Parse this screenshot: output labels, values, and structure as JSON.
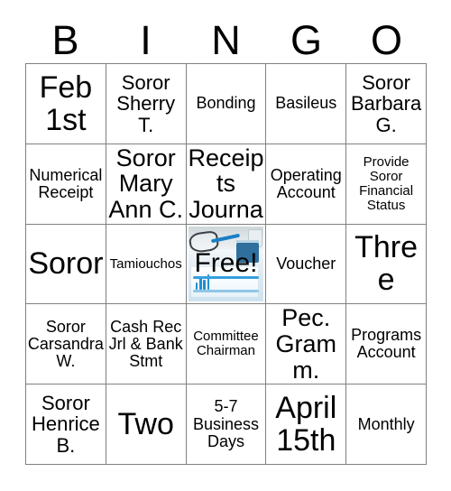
{
  "header": {
    "letters": [
      "B",
      "I",
      "N",
      "G",
      "O"
    ]
  },
  "grid": {
    "rows": [
      [
        {
          "text": "Feb 1st",
          "size": "fs-xxl",
          "free": false
        },
        {
          "text": "Soror Sherry T.",
          "size": "fs-lg",
          "free": false
        },
        {
          "text": "Bonding",
          "size": "fs-md",
          "free": false
        },
        {
          "text": "Basileus",
          "size": "fs-md",
          "free": false
        },
        {
          "text": "Soror Barbara G.",
          "size": "fs-lg",
          "free": false
        }
      ],
      [
        {
          "text": "Numerical Receipt",
          "size": "fs-md",
          "free": false
        },
        {
          "text": "Soror Mary Ann C.",
          "size": "fs-xl",
          "free": false
        },
        {
          "text": "Cash Receipts Journal",
          "size": "fs-xl",
          "free": false
        },
        {
          "text": "Operating Account",
          "size": "fs-md",
          "free": false
        },
        {
          "text": "Provide Soror Financial Status",
          "size": "fs-sm",
          "free": false
        }
      ],
      [
        {
          "text": "Soror",
          "size": "fs-xxl",
          "free": false
        },
        {
          "text": "Tamiouchos",
          "size": "fs-sm",
          "free": false
        },
        {
          "text": "Free!",
          "size": "fs-xl",
          "free": true
        },
        {
          "text": "Voucher",
          "size": "fs-md",
          "free": false
        },
        {
          "text": "Three",
          "size": "fs-xxl",
          "free": false
        }
      ],
      [
        {
          "text": "Soror Carsandra W.",
          "size": "fs-md",
          "free": false
        },
        {
          "text": "Cash Rec Jrl & Bank Stmt",
          "size": "fs-md",
          "free": false
        },
        {
          "text": "Committee Chairman",
          "size": "fs-sm",
          "free": false
        },
        {
          "text": "Pec. Gramm.",
          "size": "fs-xl",
          "free": false
        },
        {
          "text": "Programs Account",
          "size": "fs-md",
          "free": false
        }
      ],
      [
        {
          "text": "Soror Henrice B.",
          "size": "fs-lg",
          "free": false
        },
        {
          "text": "Two",
          "size": "fs-xxl",
          "free": false
        },
        {
          "text": "5-7 Business Days",
          "size": "fs-md",
          "free": false
        },
        {
          "text": "April 15th",
          "size": "fs-xxl",
          "free": false
        },
        {
          "text": "Monthly",
          "size": "fs-md",
          "free": false
        }
      ]
    ]
  },
  "free_space": {
    "label": "Free!",
    "photo_description": "office-desk-photo"
  },
  "colors": {
    "background": "#ffffff",
    "text": "#000000",
    "grid_line": "#808080",
    "photo_accent": "#1f8fd0"
  }
}
